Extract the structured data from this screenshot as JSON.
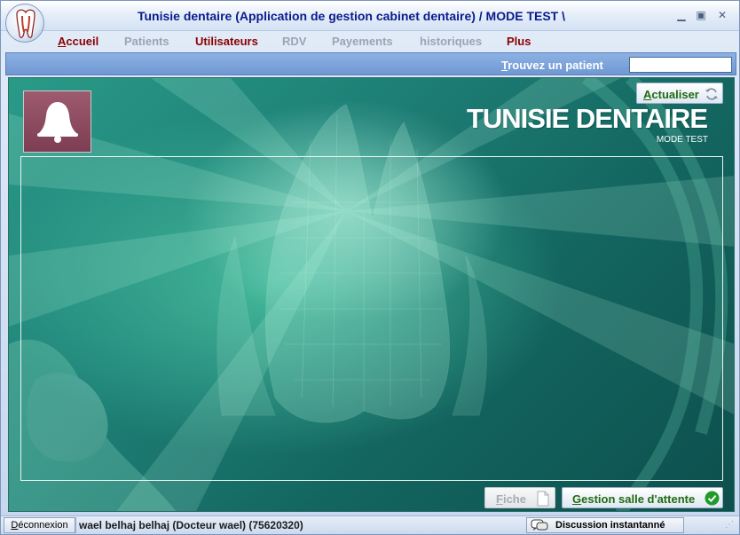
{
  "window": {
    "title": "Tunisie dentaire (Application de gestion cabinet dentaire) / MODE TEST \\",
    "app_icon": "tooth-icon"
  },
  "controls": {
    "minimize": "▁",
    "maximize": "▣",
    "close": "✕"
  },
  "menu": {
    "items": [
      {
        "hotkey": "A",
        "rest": "ccueil",
        "state": "active"
      },
      {
        "label": "Patients",
        "state": "disabled"
      },
      {
        "label": "Utilisateurs",
        "state": "active"
      },
      {
        "label": "RDV",
        "state": "disabled"
      },
      {
        "label": "Payements",
        "state": "disabled"
      },
      {
        "label": "historiques",
        "state": "disabled"
      },
      {
        "label": "Plus",
        "state": "active"
      }
    ]
  },
  "search": {
    "hotkey": "T",
    "rest": "rouvez un patient",
    "value": ""
  },
  "main": {
    "bell_icon": "bell-icon",
    "brand": "TUNISIE DENTAIRE",
    "brand_sub": "MODE TEST",
    "refresh": {
      "hotkey": "A",
      "rest": "ctualiser",
      "icon": "refresh-icon"
    },
    "fiche": {
      "hotkey": "F",
      "rest": "iche",
      "icon": "document-icon"
    },
    "salle": {
      "hotkey": "G",
      "rest": "estion salle d'attente",
      "icon": "check-circle-icon"
    }
  },
  "status": {
    "logout": {
      "hotkey": "D",
      "rest": "éconnexion"
    },
    "user": "wael belhaj belhaj (Docteur wael) (75620320)",
    "chat": {
      "label": "Discussion instantanné",
      "icon": "chat-icon"
    }
  },
  "colors": {
    "menu_active": "#8b0000",
    "menu_disabled": "#9aa4b4",
    "title": "#0a1c8c",
    "action_text": "#1f6b12"
  }
}
